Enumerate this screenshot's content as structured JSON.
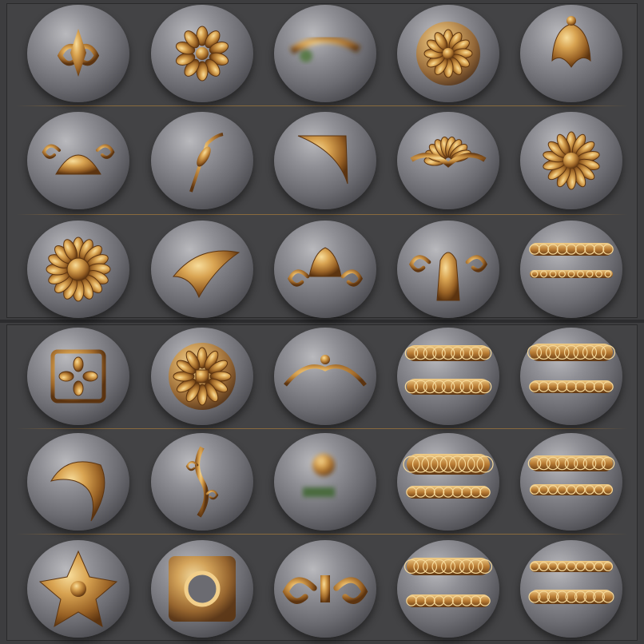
{
  "colors": {
    "background": "#3d3d3f",
    "sphere": "#7f7f85",
    "gold_light": "#f2cf8a",
    "gold_mid": "#c8903f",
    "gold_dark": "#6b3f12",
    "divider": "#a77a3a"
  },
  "brushes": [
    {
      "icon": "acanthus-scroll-icon"
    },
    {
      "icon": "carved-rosette-icon"
    },
    {
      "icon": "blurred-vine-icon"
    },
    {
      "icon": "daisy-medallion-icon"
    },
    {
      "icon": "bell-crest-icon"
    },
    {
      "icon": "shell-scroll-icon"
    },
    {
      "icon": "leaf-stem-icon"
    },
    {
      "icon": "corner-bracket-icon"
    },
    {
      "icon": "fan-crest-icon"
    },
    {
      "icon": "round-medallion-icon"
    },
    {
      "icon": "sunflower-rosette-icon"
    },
    {
      "icon": "curled-leaf-icon"
    },
    {
      "icon": "tulip-crest-icon"
    },
    {
      "icon": "fleur-crest-icon"
    },
    {
      "icon": "band-trim-icon"
    },
    {
      "icon": "square-scroll-icon"
    },
    {
      "icon": "sun-medallion-icon"
    },
    {
      "icon": "swag-garland-icon"
    },
    {
      "icon": "wide-band-trim-icon"
    },
    {
      "icon": "double-band-trim-icon"
    },
    {
      "icon": "curl-leaf-icon"
    },
    {
      "icon": "vertical-scroll-icon"
    },
    {
      "icon": "blurred-crest-icon"
    },
    {
      "icon": "lace-band-icon"
    },
    {
      "icon": "scroll-band-icon"
    },
    {
      "icon": "star-flower-icon"
    },
    {
      "icon": "square-frame-icon"
    },
    {
      "icon": "butterfly-scroll-icon"
    },
    {
      "icon": "floral-band-icon"
    },
    {
      "icon": "ivy-band-icon"
    }
  ]
}
